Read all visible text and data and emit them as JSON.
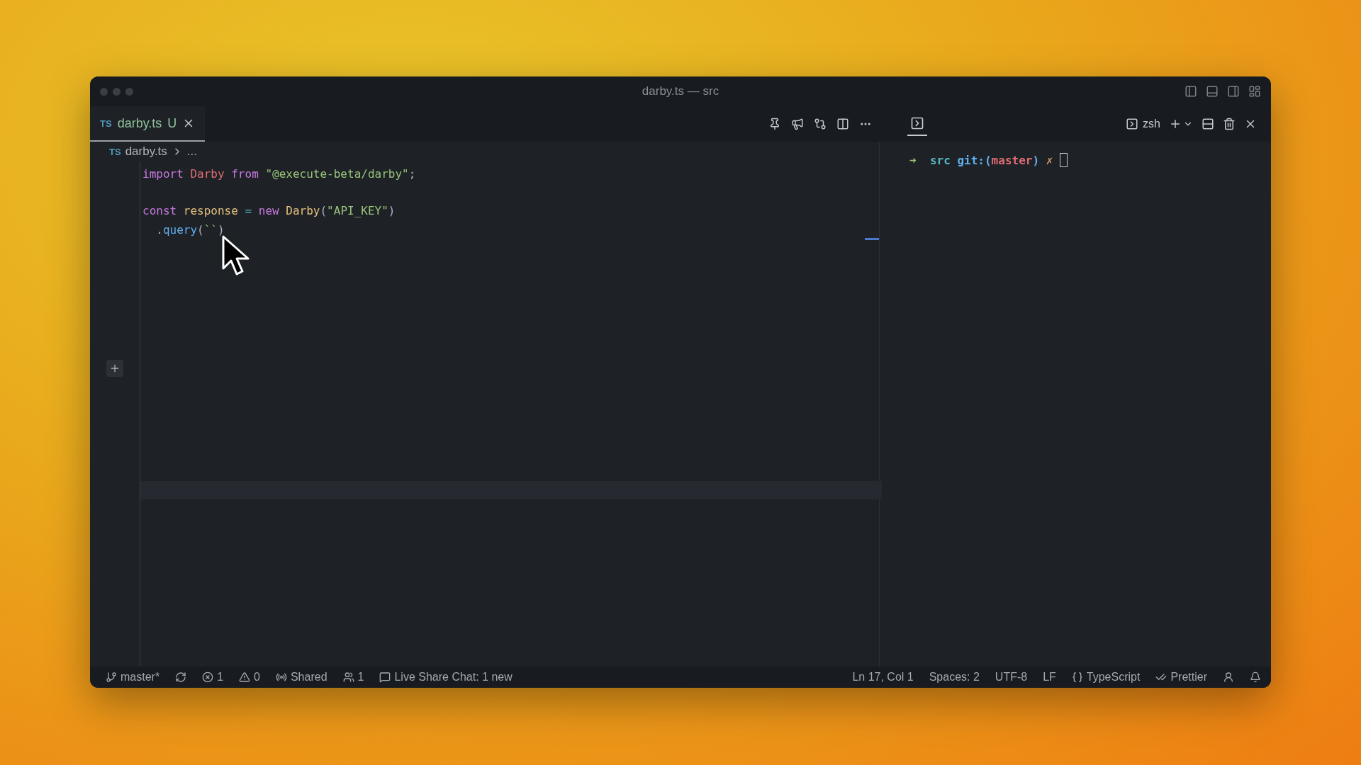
{
  "window": {
    "title": "darby.ts — src"
  },
  "editor": {
    "tabs": [
      {
        "lang": "TS",
        "label": "darby.ts",
        "status": "U",
        "selected": true
      }
    ],
    "breadcrumb": {
      "lang": "TS",
      "file": "darby.ts",
      "rest": "..."
    },
    "lines": [
      {
        "kind": "code",
        "tokens": [
          {
            "text": "import ",
            "kind": "keyword"
          },
          {
            "text": "Darby ",
            "kind": "name"
          },
          {
            "text": "from ",
            "kind": "keyword"
          },
          {
            "text": "\"@execute-beta/darby\"",
            "kind": "string"
          },
          {
            "text": ";"
          }
        ]
      },
      {
        "kind": "blank"
      },
      {
        "kind": "code",
        "tokens": [
          {
            "text": "const ",
            "kind": "keyword"
          },
          {
            "text": "response ",
            "kind": "variable"
          },
          {
            "text": "= ",
            "kind": "operator"
          },
          {
            "text": "new ",
            "kind": "keyword"
          },
          {
            "text": "Darby",
            "kind": "variable"
          },
          {
            "text": "("
          },
          {
            "text": "\"API_KEY\"",
            "kind": "string"
          },
          {
            "text": ")"
          }
        ]
      },
      {
        "kind": "code",
        "tokens": [
          {
            "text": "  ."
          },
          {
            "text": "query",
            "kind": "method"
          },
          {
            "text": "("
          },
          {
            "text": "``",
            "kind": "string"
          },
          {
            "text": ")"
          }
        ]
      }
    ]
  },
  "terminal": {
    "tab": {
      "label": "zsh"
    },
    "prompt": [
      {
        "text": "➜  ",
        "kind": "arrow"
      },
      {
        "text": "src ",
        "kind": "dir"
      },
      {
        "text": "git:(",
        "kind": "git"
      },
      {
        "text": "master",
        "kind": "branch"
      },
      {
        "text": ") ",
        "kind": "git"
      },
      {
        "text": "✗ ",
        "kind": "dirty"
      }
    ]
  },
  "status_bar": {
    "left": [
      {
        "kind": "branch",
        "text": "master*"
      },
      {
        "kind": "sync"
      },
      {
        "kind": "error",
        "text": "1"
      },
      {
        "kind": "warning",
        "text": "0"
      },
      {
        "kind": "broadcast",
        "text": "Shared"
      },
      {
        "kind": "people",
        "text": "1"
      },
      {
        "kind": "chat",
        "text": "Live Share Chat: 1 new"
      }
    ],
    "right": [
      {
        "kind": "plain",
        "text": "Ln 17, Col 1"
      },
      {
        "kind": "plain",
        "text": "Spaces: 2"
      },
      {
        "kind": "plain",
        "text": "UTF-8"
      },
      {
        "kind": "plain",
        "text": "LF"
      },
      {
        "kind": "braces",
        "text": "TypeScript"
      },
      {
        "kind": "checks",
        "text": "Prettier"
      },
      {
        "kind": "account"
      },
      {
        "kind": "bell"
      }
    ]
  }
}
